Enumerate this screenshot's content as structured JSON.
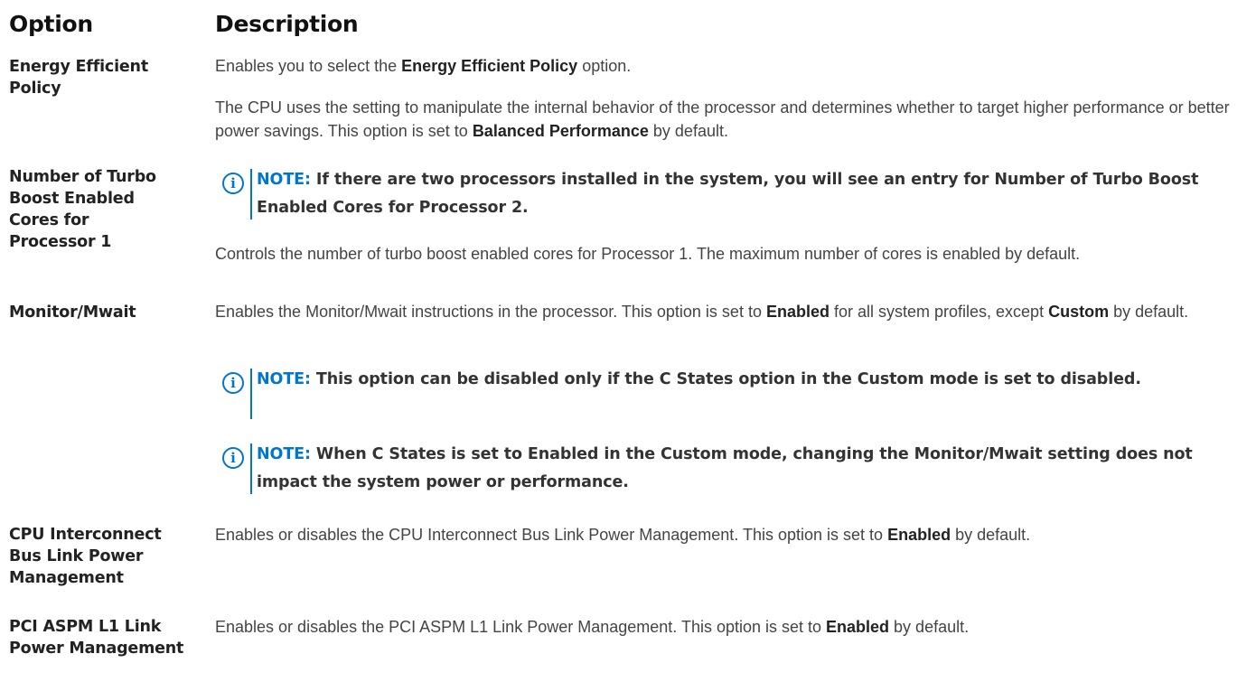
{
  "header": {
    "option": "Option",
    "description": "Description"
  },
  "note_label": "NOTE:",
  "rows": {
    "energy": {
      "option": "Energy Efficient Policy",
      "p1_pre": "Enables you to select the ",
      "p1_bold": "Energy Efficient Policy",
      "p1_post": " option.",
      "p2_pre": "The CPU uses the setting to manipulate the internal behavior of the processor and determines whether to target higher performance or better power savings. This option is set to ",
      "p2_bold": "Balanced Performance",
      "p2_post": " by default."
    },
    "turbo": {
      "option": "Number of Turbo Boost Enabled Cores for Processor 1",
      "note": "If there are two processors installed in the system, you will see an entry for Number of Turbo Boost Enabled Cores for Processor 2.",
      "desc": "Controls the number of turbo boost enabled cores for Processor 1. The maximum number of cores is enabled by default."
    },
    "mwait": {
      "option": "Monitor/Mwait",
      "d_pre": "Enables the Monitor/Mwait instructions in the processor. This option is set to ",
      "d_bold1": "Enabled",
      "d_mid": " for all system profiles, except ",
      "d_bold2": "Custom",
      "d_post": " by default.",
      "note1": "This option can be disabled only if the C States option in the Custom mode is set to disabled.",
      "note2": "When C States is set to Enabled in the Custom mode, changing the Monitor/Mwait setting does not impact the system power or performance."
    },
    "cpu_link": {
      "option": "CPU Interconnect Bus Link Power Management",
      "d_pre": "Enables or disables the CPU Interconnect Bus Link Power Management. This option is set to ",
      "d_bold": "Enabled",
      "d_post": " by default."
    },
    "pci": {
      "option": "PCI ASPM L1 Link Power Management",
      "d_pre": "Enables or disables the PCI ASPM L1 Link Power Management. This option is set to ",
      "d_bold": "Enabled",
      "d_post": " by default."
    }
  },
  "icons": {
    "note": "info-circle-icon"
  },
  "colors": {
    "accent": "#0076ce",
    "text": "#444444",
    "heading": "#111111"
  }
}
